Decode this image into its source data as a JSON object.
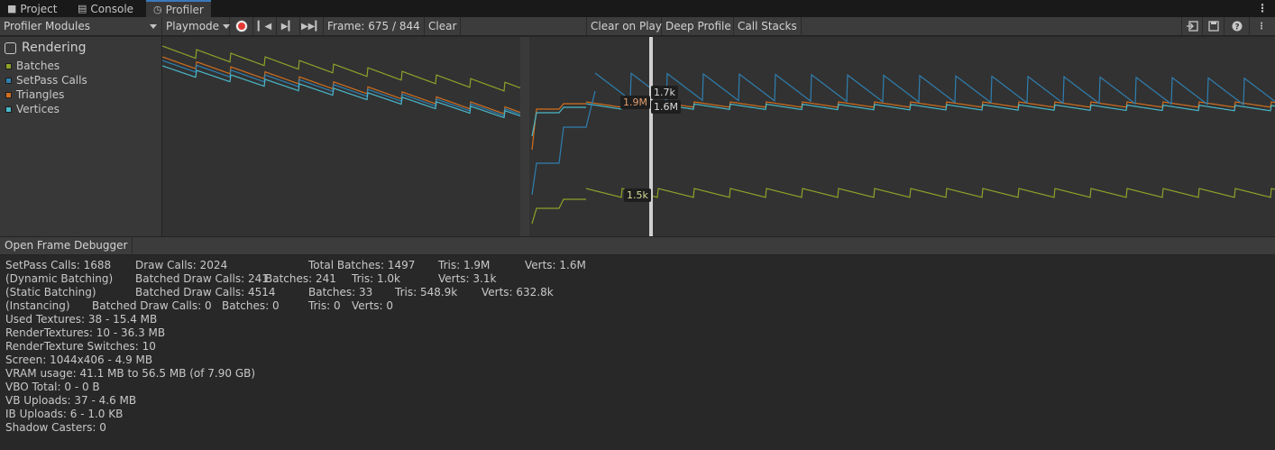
{
  "tabs": [
    {
      "label": "Project",
      "icon": "folder-icon",
      "active": false
    },
    {
      "label": "Console",
      "icon": "console-icon",
      "active": false
    },
    {
      "label": "Profiler",
      "icon": "profiler-icon",
      "active": true
    }
  ],
  "toolbar": {
    "modules_label": "Profiler Modules",
    "playmode_label": "Playmode",
    "frame_label": "Frame: 675 / 844",
    "clear_label": "Clear",
    "clear_on_play_label": "Clear on Play",
    "deep_profile_label": "Deep Profile",
    "call_stacks_label": "Call Stacks"
  },
  "module": {
    "title": "Rendering",
    "legend": [
      {
        "name": "Batches",
        "color": "#8ca32a"
      },
      {
        "name": "SetPass Calls",
        "color": "#2f7fb0"
      },
      {
        "name": "Triangles",
        "color": "#d26f1e"
      },
      {
        "name": "Vertices",
        "color": "#49b8c9"
      }
    ]
  },
  "chart_values": {
    "tris_label": "1.9M",
    "setpass_label": "1.7k",
    "verts_label": "1.6M",
    "batches_label": "1.5k"
  },
  "subbar": {
    "open_frame_debugger": "Open Frame Debugger"
  },
  "stats": {
    "row1": {
      "setpass": "SetPass Calls: 1688",
      "draw_calls": "Draw Calls: 2024",
      "total_batches": "Total Batches: 1497",
      "tris": "Tris: 1.9M",
      "verts": "Verts: 1.6M"
    },
    "row2": {
      "label": "(Dynamic Batching)",
      "batched": "Batched Draw Calls: 241",
      "batches": "Batches: 241",
      "tris": "Tris: 1.0k",
      "verts": "Verts: 3.1k"
    },
    "row3": {
      "label": "(Static Batching)",
      "batched": "Batched Draw Calls: 4514",
      "batches": "Batches: 33",
      "tris": "Tris: 548.9k",
      "verts": "Verts: 632.8k"
    },
    "row4": {
      "label": "(Instancing)",
      "batched": "Batched Draw Calls: 0",
      "batches": "Batches: 0",
      "tris": "Tris: 0",
      "verts": "Verts: 0"
    },
    "used_textures": "Used Textures: 38 - 15.4 MB",
    "render_textures": "RenderTextures: 10 - 36.3 MB",
    "render_texture_switches": "RenderTexture Switches: 10",
    "screen": "Screen: 1044x406 - 4.9 MB",
    "vram": "VRAM usage: 41.1 MB to 56.5 MB (of 7.90 GB)",
    "vbo_total": "VBO Total: 0 - 0 B",
    "vb_uploads": "VB Uploads: 37 - 4.6 MB",
    "ib_uploads": "IB Uploads: 6 - 1.0 KB",
    "shadow_casters": "Shadow Casters: 0"
  }
}
